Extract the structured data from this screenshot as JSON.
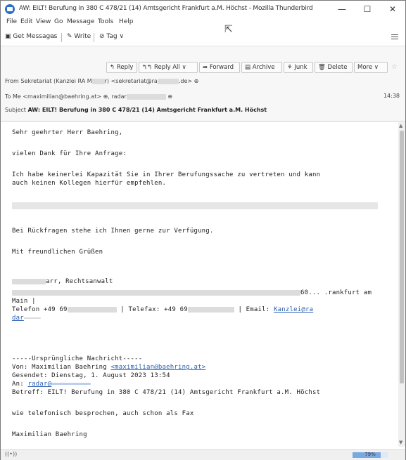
{
  "window": {
    "title": "AW: EILT! Berufung in 380 C 478/21 (14) Amtsgericht Frankfurt a.M. Höchst - Mozilla Thunderbird",
    "minimize": "—",
    "maximize": "☐",
    "close": "✕"
  },
  "menu": [
    "File",
    "Edit",
    "View",
    "Go",
    "Message",
    "Tools",
    "Help"
  ],
  "toolbar": {
    "get_messages": "Get Messages",
    "write": "Write",
    "tag": "Tag"
  },
  "actions": {
    "reply": "Reply",
    "reply_all": "Reply All",
    "forward": "Forward",
    "archive": "Archive",
    "junk": "Junk",
    "delete": "Delete",
    "more": "More"
  },
  "header": {
    "from_label": "From",
    "from_name_a": "Sekretariat (Kanzlei RA M",
    "from_name_b": "r) <sekretariat@ra",
    "from_name_c": ".de>",
    "to_label": "To",
    "to_value_a": "Me <maximilian@baehring.at>",
    "to_value_b": ", radar",
    "time": "14:38",
    "subject_label": "Subject",
    "subject": "AW: EILT! Berufung in 380 C 478/21 (14) Amtsgericht Frankfurt a.M. Höchst"
  },
  "body": {
    "greeting": "Sehr geehrter Herr Baehring,",
    "thanks": "vielen Dank für Ihre Anfrage:",
    "para1_l1": "Ich habe keinerlei Kapazität Sie in Ihrer Berufungssache zu vertreten und kann",
    "para1_l2": "auch keinen Kollegen hierfür empfehlen.",
    "questions": "Bei Rückfragen stehe ich Ihnen gerne zur Verfügung.",
    "closing": "Mit freundlichen Grüßen",
    "sig_name": "arr, Rechtsanwalt",
    "sig_city": "60... .rankfurt am",
    "sig_main": "Main |",
    "sig_tel": "Telefon +49 69",
    "sig_fax": "| Telefax: +49 69",
    "sig_email_label": "| Email:",
    "sig_email": "Kanzlei@ra",
    "sig_email_cont": "dar",
    "orig_header": "-----Ursprüngliche Nachricht-----",
    "orig_from_label": "Von: Maximilian Baehring",
    "orig_from_link": "<maximilian@baehring.at>",
    "orig_sent": "Gesendet: Dienstag, 1. August 2023 13:54",
    "orig_to_label": "An:",
    "orig_to_link": "radar@",
    "orig_subject": "Betreff: EILT! Berufung in 380 C 478/21 (14) Amtsgericht Frankfurt a.M. Höchst",
    "orig_text": "wie telefonisch besprochen, auch schon als Fax",
    "orig_sig": "Maximilian Baehring"
  },
  "status": {
    "icon": "((•))",
    "progress": 0.79,
    "progress_label": "79%"
  }
}
